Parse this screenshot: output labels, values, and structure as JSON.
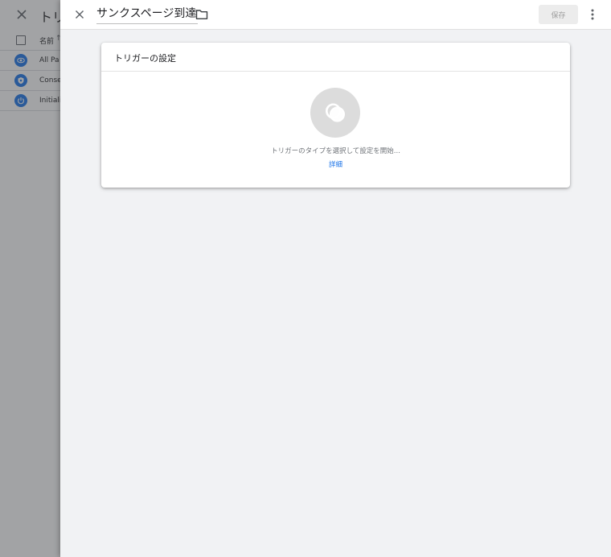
{
  "background_panel": {
    "title": "トリ",
    "table_header": {
      "name_label": "名前",
      "sort_indicator": "↑"
    },
    "rows": [
      {
        "label": "All Pa",
        "icon": "eye-icon"
      },
      {
        "label": "Conse",
        "icon": "consent-shield-icon"
      },
      {
        "label": "Initiali",
        "icon": "power-icon"
      }
    ]
  },
  "editor": {
    "name_value": "サンクスページ到達",
    "save_label": "保存",
    "close_icon": "close-icon",
    "folder_icon": "folder-icon",
    "menu_icon": "more-vert-icon"
  },
  "card": {
    "title": "トリガーの設定",
    "hint": "トリガーのタイプを選択して設定を開始...",
    "learn_more": "詳細",
    "center_icon": "trigger-rings-icon"
  },
  "colors": {
    "accent": "#1a73e8",
    "sheet_background": "#f1f2f4",
    "scrim": "#3c3e42",
    "save_disabled_bg": "#ececec",
    "save_disabled_text": "#9e9e9e"
  }
}
